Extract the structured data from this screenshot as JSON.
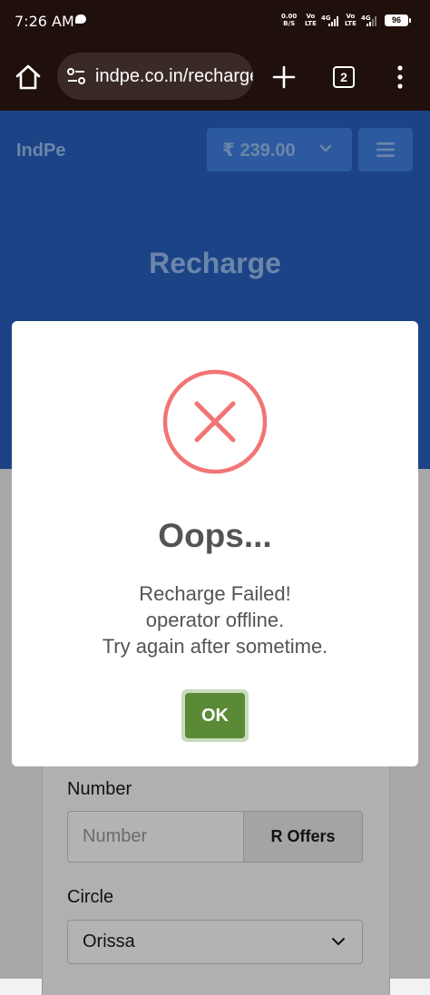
{
  "status_bar": {
    "time": "7:26 AM",
    "speed_value": "0.00",
    "speed_unit": "B/S",
    "sim1_top": "Vo",
    "sim1_bottom": "LTE",
    "sim1_gen": "4G",
    "sim2_top": "Vo",
    "sim2_bottom": "LTE",
    "sim2_gen": "4G",
    "battery": "96"
  },
  "browser": {
    "url": "indpe.co.in/recharge",
    "tab_count": "2"
  },
  "header": {
    "brand": "IndPe",
    "balance": "₹ 239.00",
    "title": "Recharge"
  },
  "form": {
    "number_label": "Number",
    "number_placeholder": "Number",
    "roffers_label": "R Offers",
    "circle_label": "Circle",
    "circle_value": "Orissa"
  },
  "modal": {
    "title": "Oops...",
    "line1": "Recharge Failed!",
    "line2": "operator offline.",
    "line3": "Try again after sometime.",
    "ok_label": "OK"
  },
  "colors": {
    "status_bg": "#1f100c",
    "header_blue": "#1b4386",
    "error_red": "#f27474",
    "ok_green": "#5a8a35"
  }
}
